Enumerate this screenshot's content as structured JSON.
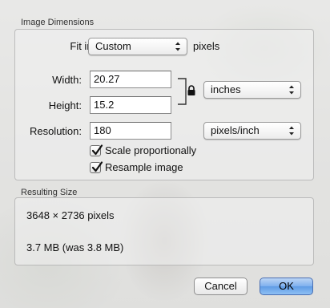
{
  "image_dimensions": {
    "section_label": "Image Dimensions",
    "fit_into_label": "Fit into:",
    "fit_into_value": "Custom",
    "fit_into_unit": "pixels",
    "width_label": "Width:",
    "width_value": "20.27",
    "height_label": "Height:",
    "height_value": "15.2",
    "size_unit": "inches",
    "resolution_label": "Resolution:",
    "resolution_value": "180",
    "resolution_unit": "pixels/inch",
    "scale_proportionally_label": "Scale proportionally",
    "scale_proportionally_checked": true,
    "resample_label": "Resample image",
    "resample_checked": true
  },
  "resulting_size": {
    "section_label": "Resulting Size",
    "pixels": "3648 × 2736 pixels",
    "file_size": "3.7 MB (was 3.8 MB)"
  },
  "buttons": {
    "cancel_label": "Cancel",
    "ok_label": "OK"
  },
  "colors": {
    "default_button": "#6fa6eb"
  }
}
